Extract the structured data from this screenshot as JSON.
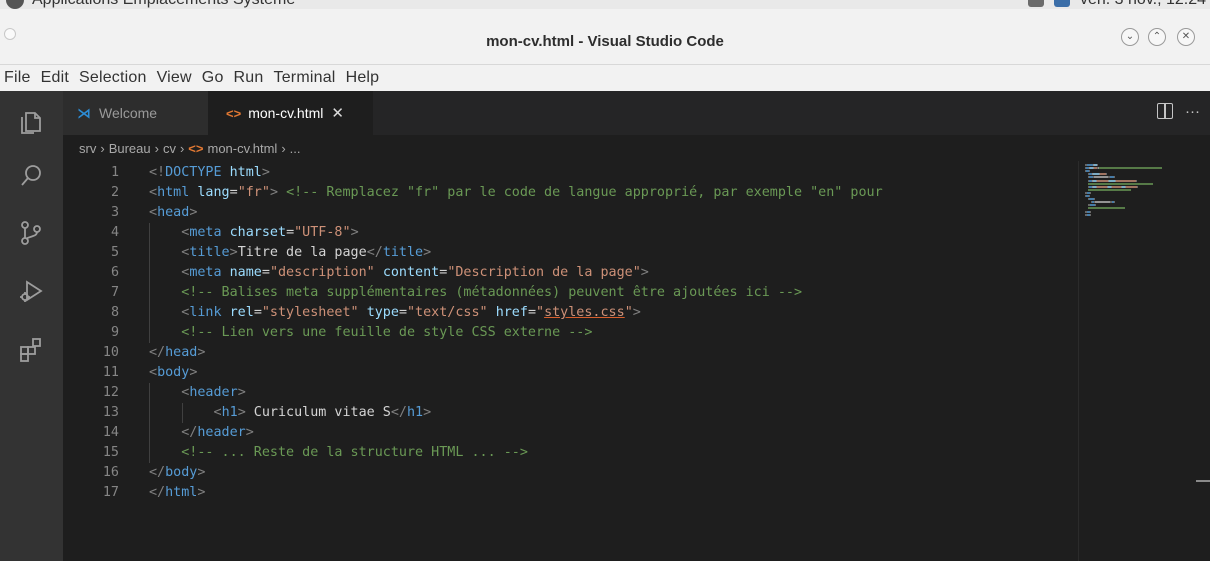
{
  "system_panel": {
    "menu": "Applications  Emplacements  Système",
    "clock": "ven. 3 nov., 12:24"
  },
  "window": {
    "title": "mon-cv.html - Visual Studio Code"
  },
  "menubar": {
    "items": [
      "File",
      "Edit",
      "Selection",
      "View",
      "Go",
      "Run",
      "Terminal",
      "Help"
    ]
  },
  "tabs": [
    {
      "label": "Welcome",
      "active": false
    },
    {
      "label": "mon-cv.html",
      "active": true
    }
  ],
  "breadcrumb": [
    "srv",
    "Bureau",
    "cv",
    "mon-cv.html",
    "..."
  ],
  "colors": {
    "tag": "#569cd6",
    "attribute": "#9cdcfe",
    "string": "#ce9178",
    "comment": "#6a9955",
    "text": "#d4d4d4",
    "html_file_icon": "#e37933",
    "vscode_blue": "#2d8dd6"
  },
  "editor": {
    "lines": [
      {
        "n": "1",
        "indent": 0,
        "tokens": [
          [
            "punc",
            "<!"
          ],
          [
            "tag",
            "DOCTYPE"
          ],
          [
            "text",
            " "
          ],
          [
            "attr",
            "html"
          ],
          [
            "punc",
            ">"
          ]
        ]
      },
      {
        "n": "2",
        "indent": 0,
        "tokens": [
          [
            "punc",
            "<"
          ],
          [
            "tag",
            "html"
          ],
          [
            "text",
            " "
          ],
          [
            "attr",
            "lang"
          ],
          [
            "text",
            "="
          ],
          [
            "str",
            "\"fr\""
          ],
          [
            "punc",
            ">"
          ],
          [
            "text",
            " "
          ],
          [
            "com",
            "<!-- Remplacez \"fr\" par le code de langue approprié, par exemple \"en\" pour"
          ]
        ]
      },
      {
        "n": "3",
        "indent": 0,
        "tokens": [
          [
            "punc",
            "<"
          ],
          [
            "tag",
            "head"
          ],
          [
            "punc",
            ">"
          ]
        ]
      },
      {
        "n": "4",
        "indent": 1,
        "tokens": [
          [
            "punc",
            "<"
          ],
          [
            "tag",
            "meta"
          ],
          [
            "text",
            " "
          ],
          [
            "attr",
            "charset"
          ],
          [
            "text",
            "="
          ],
          [
            "str",
            "\"UTF-8\""
          ],
          [
            "punc",
            ">"
          ]
        ]
      },
      {
        "n": "5",
        "indent": 1,
        "tokens": [
          [
            "punc",
            "<"
          ],
          [
            "tag",
            "title"
          ],
          [
            "punc",
            ">"
          ],
          [
            "text",
            "Titre de la page"
          ],
          [
            "punc",
            "</"
          ],
          [
            "tag",
            "title"
          ],
          [
            "punc",
            ">"
          ]
        ]
      },
      {
        "n": "6",
        "indent": 1,
        "tokens": [
          [
            "punc",
            "<"
          ],
          [
            "tag",
            "meta"
          ],
          [
            "text",
            " "
          ],
          [
            "attr",
            "name"
          ],
          [
            "text",
            "="
          ],
          [
            "str",
            "\"description\""
          ],
          [
            "text",
            " "
          ],
          [
            "attr",
            "content"
          ],
          [
            "text",
            "="
          ],
          [
            "str",
            "\"Description de la page\""
          ],
          [
            "punc",
            ">"
          ]
        ]
      },
      {
        "n": "7",
        "indent": 1,
        "tokens": [
          [
            "com",
            "<!-- Balises meta supplémentaires (métadonnées) peuvent être ajoutées ici -->"
          ]
        ]
      },
      {
        "n": "8",
        "indent": 1,
        "tokens": [
          [
            "punc",
            "<"
          ],
          [
            "tag",
            "link"
          ],
          [
            "text",
            " "
          ],
          [
            "attr",
            "rel"
          ],
          [
            "text",
            "="
          ],
          [
            "str",
            "\"stylesheet\""
          ],
          [
            "text",
            " "
          ],
          [
            "attr",
            "type"
          ],
          [
            "text",
            "="
          ],
          [
            "str",
            "\"text/css\""
          ],
          [
            "text",
            " "
          ],
          [
            "attr",
            "href"
          ],
          [
            "text",
            "="
          ],
          [
            "str",
            "\""
          ],
          [
            "link",
            "styles.css"
          ],
          [
            "str",
            "\""
          ],
          [
            "punc",
            ">"
          ]
        ]
      },
      {
        "n": "9",
        "indent": 1,
        "tokens": [
          [
            "com",
            "<!-- Lien vers une feuille de style CSS externe -->"
          ]
        ]
      },
      {
        "n": "10",
        "indent": 0,
        "tokens": [
          [
            "punc",
            "</"
          ],
          [
            "tag",
            "head"
          ],
          [
            "punc",
            ">"
          ]
        ]
      },
      {
        "n": "11",
        "indent": 0,
        "tokens": [
          [
            "punc",
            "<"
          ],
          [
            "tag",
            "body"
          ],
          [
            "punc",
            ">"
          ]
        ]
      },
      {
        "n": "12",
        "indent": 1,
        "tokens": [
          [
            "punc",
            "<"
          ],
          [
            "tag",
            "header"
          ],
          [
            "punc",
            ">"
          ]
        ]
      },
      {
        "n": "13",
        "indent": 2,
        "tokens": [
          [
            "punc",
            "<"
          ],
          [
            "tag",
            "h1"
          ],
          [
            "punc",
            ">"
          ],
          [
            "text",
            " Curiculum vitae S"
          ],
          [
            "punc",
            "</"
          ],
          [
            "tag",
            "h1"
          ],
          [
            "punc",
            ">"
          ]
        ]
      },
      {
        "n": "14",
        "indent": 1,
        "tokens": [
          [
            "punc",
            "</"
          ],
          [
            "tag",
            "header"
          ],
          [
            "punc",
            ">"
          ]
        ]
      },
      {
        "n": "15",
        "indent": 1,
        "tokens": [
          [
            "com",
            "<!-- ... Reste de la structure HTML ... -->"
          ]
        ]
      },
      {
        "n": "16",
        "indent": 0,
        "tokens": [
          [
            "punc",
            "</"
          ],
          [
            "tag",
            "body"
          ],
          [
            "punc",
            ">"
          ]
        ]
      },
      {
        "n": "17",
        "indent": 0,
        "tokens": [
          [
            "punc",
            "</"
          ],
          [
            "tag",
            "html"
          ],
          [
            "punc",
            ">"
          ]
        ]
      }
    ]
  }
}
